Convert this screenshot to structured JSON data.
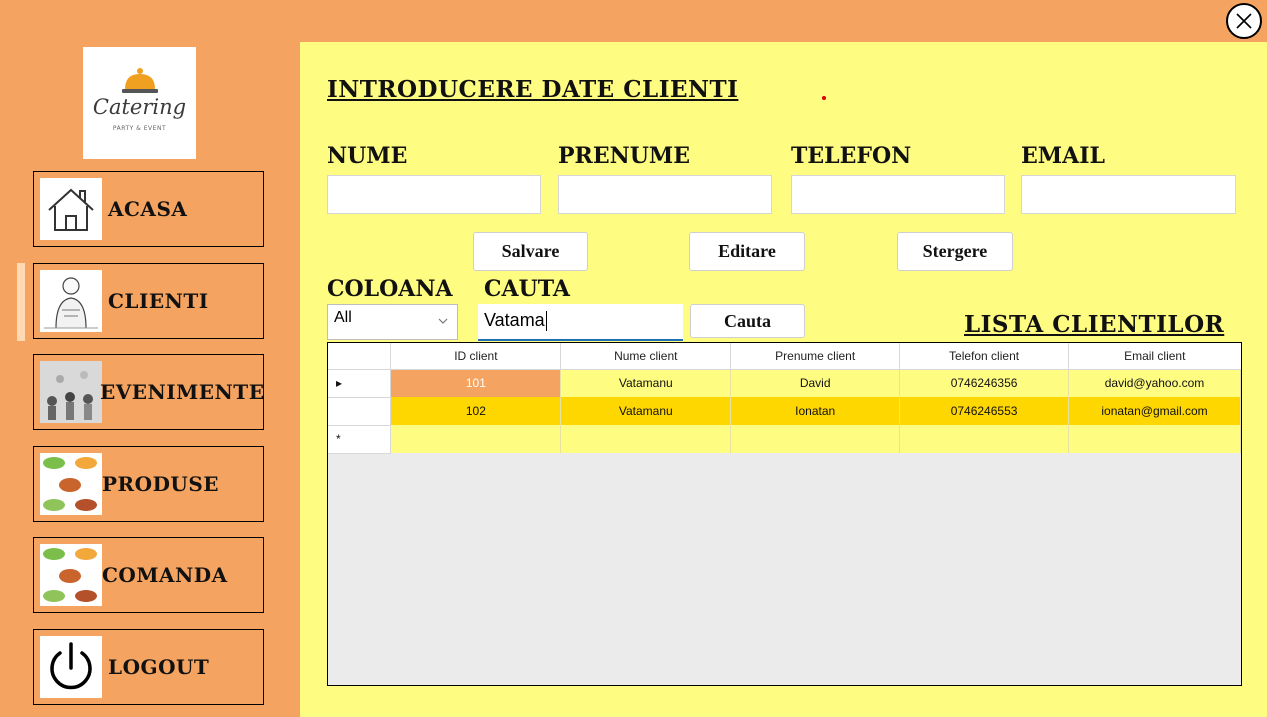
{
  "window": {
    "close_label": "close"
  },
  "logo": {
    "brand": "Catering",
    "tagline": "PARTY & EVENT"
  },
  "sidebar": {
    "items": [
      {
        "label": "ACASA",
        "icon": "home-icon"
      },
      {
        "label": "CLIENTI",
        "icon": "client-photo-icon"
      },
      {
        "label": "EVENIMENTE",
        "icon": "event-photo-icon"
      },
      {
        "label": "PRODUSE",
        "icon": "food-photo-icon"
      },
      {
        "label": "COMANDA",
        "icon": "food-photo-icon"
      },
      {
        "label": "LOGOUT",
        "icon": "power-icon"
      }
    ],
    "active": "CLIENTI"
  },
  "form": {
    "title": "INTRODUCERE DATE CLIENTI",
    "fields": [
      {
        "label": "NUME",
        "value": ""
      },
      {
        "label": "PRENUME",
        "value": ""
      },
      {
        "label": "TELEFON",
        "value": ""
      },
      {
        "label": "EMAIL",
        "value": ""
      }
    ],
    "buttons": {
      "save": "Salvare",
      "edit": "Editare",
      "delete": "Stergere"
    }
  },
  "search": {
    "column_label": "COLOANA",
    "search_label": "CAUTA",
    "column_selected": "All",
    "query": "Vatama",
    "button": "Cauta"
  },
  "list": {
    "title": "LISTA CLIENTILOR",
    "columns": [
      "ID client",
      "Nume client",
      "Prenume client",
      "Telefon client",
      "Email client"
    ],
    "rows": [
      [
        "101",
        "Vatamanu",
        "David",
        "0746246356",
        "david@yahoo.com"
      ],
      [
        "102",
        "Vatamanu",
        "Ionatan",
        "0746246553",
        "ionatan@gmail.com"
      ]
    ],
    "new_row_marker": "*",
    "current_row_marker": "▸"
  },
  "colors": {
    "sidebar_bg": "#F4A460",
    "main_bg": "#FFFC82",
    "selected_row": "#FFD700",
    "accent_underline": "#1F6FB2"
  }
}
